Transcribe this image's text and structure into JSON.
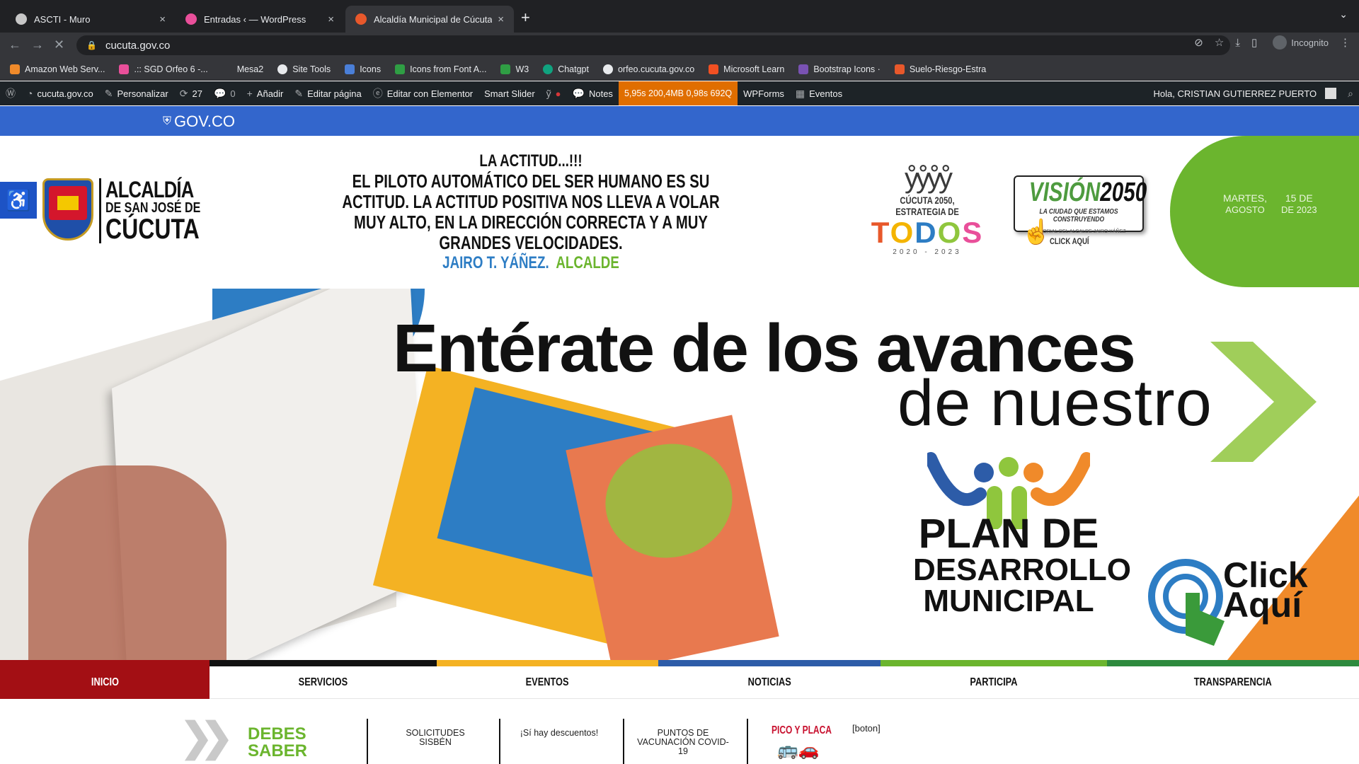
{
  "browser": {
    "tabs": [
      {
        "title": "ASCTI - Muro",
        "color": "#c7c7c7"
      },
      {
        "title": "Entradas ‹ — WordPress",
        "color": "#e94f9a"
      },
      {
        "title": "Alcaldía Municipal de Cúcuta",
        "color": "#e8582b"
      }
    ],
    "new_tab": "+",
    "close": "×",
    "url": "cucuta.gov.co",
    "incognito_label": "Incognito",
    "bookmarks": [
      {
        "label": "Amazon Web Serv...",
        "color": "#f08a2a"
      },
      {
        "label": ".:: SGD Orfeo 6 -...",
        "color": "#e94f9a"
      },
      {
        "label": "Mesa2",
        "color": "#35363a"
      },
      {
        "label": "Site Tools",
        "color": "#e8eaed"
      },
      {
        "label": "Icons",
        "color": "#4a7fd8"
      },
      {
        "label": "Icons from Font A...",
        "color": "#2f9e44"
      },
      {
        "label": "W3",
        "color": "#2f9e44"
      },
      {
        "label": "Chatgpt",
        "color": "#10a37f"
      },
      {
        "label": "orfeo.cucuta.gov.co",
        "color": "#e8eaed"
      },
      {
        "label": "Microsoft Learn",
        "color": "#f25022"
      },
      {
        "label": "Bootstrap Icons ·",
        "color": "#7952b3"
      },
      {
        "label": "Suelo-Riesgo-Estra",
        "color": "#e8582b"
      }
    ]
  },
  "wpbar": {
    "site": "cucuta.gov.co",
    "customize": "Personalizar",
    "updates": "27",
    "comments": "0",
    "add": "Añadir",
    "edit_page": "Editar página",
    "edit_elementor": "Editar con Elementor",
    "smart_slider": "Smart Slider",
    "notes": "Notes",
    "qm": "5,95s  200,4MB  0,98s  692Q",
    "wpforms": "WPForms",
    "events": "Eventos",
    "greeting": "Hola, CRISTIAN GUTIERREZ PUERTO"
  },
  "gov": {
    "logo": "GOV.CO"
  },
  "header": {
    "alcaldia_line1": "ALCALDÍA",
    "alcaldia_line2": "DE SAN JOSÉ DE",
    "alcaldia_line3": "CÚCUTA",
    "quote_title": "LA ACTITUD...!!!",
    "quote_body": "EL PILOTO AUTOMÁTICO DEL SER HUMANO ES SU ACTITUD. LA ACTITUD POSITIVA NOS LLEVA A VOLAR MUY ALTO, EN LA DIRECCIÓN CORRECTA Y A MUY GRANDES VELOCIDADES.",
    "quote_author": "JAIRO T. YÁÑEZ.",
    "quote_role": "ALCALDE",
    "todos_caption": "CÚCUTA 2050, ESTRATEGIA DE",
    "todos_letters": [
      "T",
      "O",
      "D",
      "O",
      "S"
    ],
    "todos_years": "2020 - 2023",
    "vision_a": "VISIÓN",
    "vision_b": "2050",
    "vision_sub": "LA CIUDAD QUE ESTAMOS CONSTRUYENDO",
    "vision_small": "EDITORIAL DEL ALCALDE JAIRO YÁÑEZ",
    "vision_click": "CLICK AQUÍ",
    "weekday": "MARTES,",
    "month": "AGOSTO",
    "day": "15 DE",
    "year": "DE 2023"
  },
  "banner": {
    "title": "Entérate de los avances",
    "subtitle": "de nuestro",
    "plan_line1": "PLAN DE",
    "plan_line2": "DESARROLLO",
    "plan_line3": "MUNICIPAL",
    "click_line1": "Click",
    "click_line2": "Aquí"
  },
  "nav": {
    "strip_colors": [
      "#a30f14",
      "#111111",
      "#f4b223",
      "#2d5ca8",
      "#6bb52e",
      "#2d8a3e"
    ],
    "items": [
      "INICIO",
      "SERVICIOS",
      "EVENTOS",
      "NOTICIAS",
      "PARTICIPA",
      "TRANSPARENCIA"
    ],
    "active_color": "#a30f14"
  },
  "debes": {
    "title_line1": "DEBES",
    "title_line2": "SABER",
    "items": [
      "SOLICITUDES SISBÉN",
      "¡Sí hay descuentos!",
      "PUNTOS DE VACUNACIÓN COVID-19"
    ],
    "pico": "PICO Y PLACA",
    "boton": "[boton]"
  }
}
